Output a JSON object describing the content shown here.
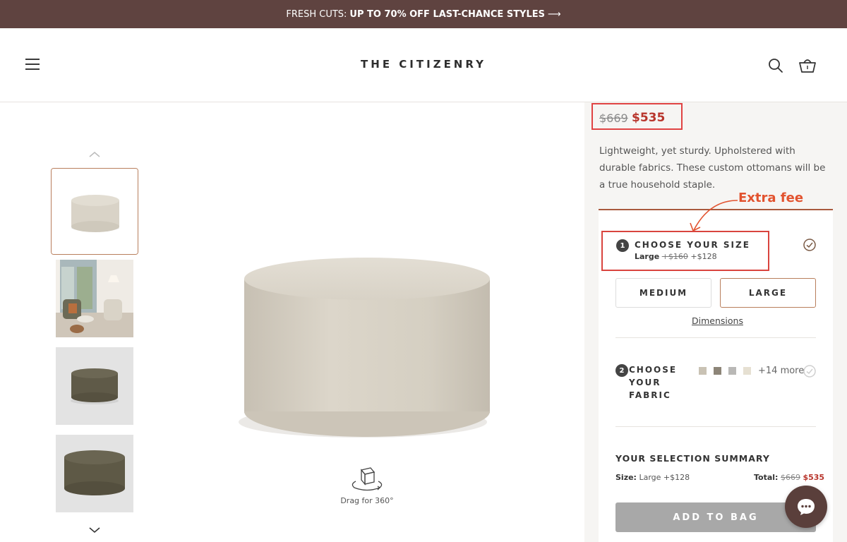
{
  "promo": {
    "prefix": "FRESH CUTS:",
    "bold": "UP TO 70% OFF LAST-CHANCE STYLES",
    "arrow": "⟶"
  },
  "header": {
    "logo": "THE CITIZENRY",
    "icons": [
      "menu-icon",
      "search-icon",
      "cart-icon"
    ]
  },
  "gallery": {
    "thumbnails": [
      "ottoman-beige",
      "living-room-scene",
      "ottoman-olive-grey-bg",
      "ottoman-olive-close"
    ],
    "drag_label": "Drag for 360°"
  },
  "product": {
    "price_old": "$669",
    "price_new": "$535",
    "description": "Lightweight, yet sturdy. Upholstered with durable fabrics. These custom ottomans will be a true household staple."
  },
  "annotation": {
    "label": "Extra fee",
    "color": "#e2532f"
  },
  "step1": {
    "num": "1",
    "title": "CHOOSE YOUR SIZE",
    "selected": "Large",
    "fee_old": "+$160",
    "fee_new": "+$128",
    "options": [
      "MEDIUM",
      "LARGE"
    ],
    "selected_option": "LARGE",
    "dimensions_link": "Dimensions"
  },
  "step2": {
    "num": "2",
    "title": "CHOOSE YOUR FABRIC",
    "swatches": [
      "#c9c2b4",
      "#8d8578",
      "#b9b8b6",
      "#e6e0d2"
    ],
    "more": "+14 more"
  },
  "summary": {
    "title": "YOUR SELECTION SUMMARY",
    "size_label": "Size:",
    "size_value": "Large +$128",
    "total_label": "Total:",
    "total_old": "$669",
    "total_new": "$535"
  },
  "cta": {
    "add_to_bag": "ADD TO BAG"
  },
  "colors": {
    "promo_bg": "#5f4340",
    "accent_price": "#b8352c",
    "highlight_box": "#e04343",
    "selected_border": "#b87e5c"
  }
}
